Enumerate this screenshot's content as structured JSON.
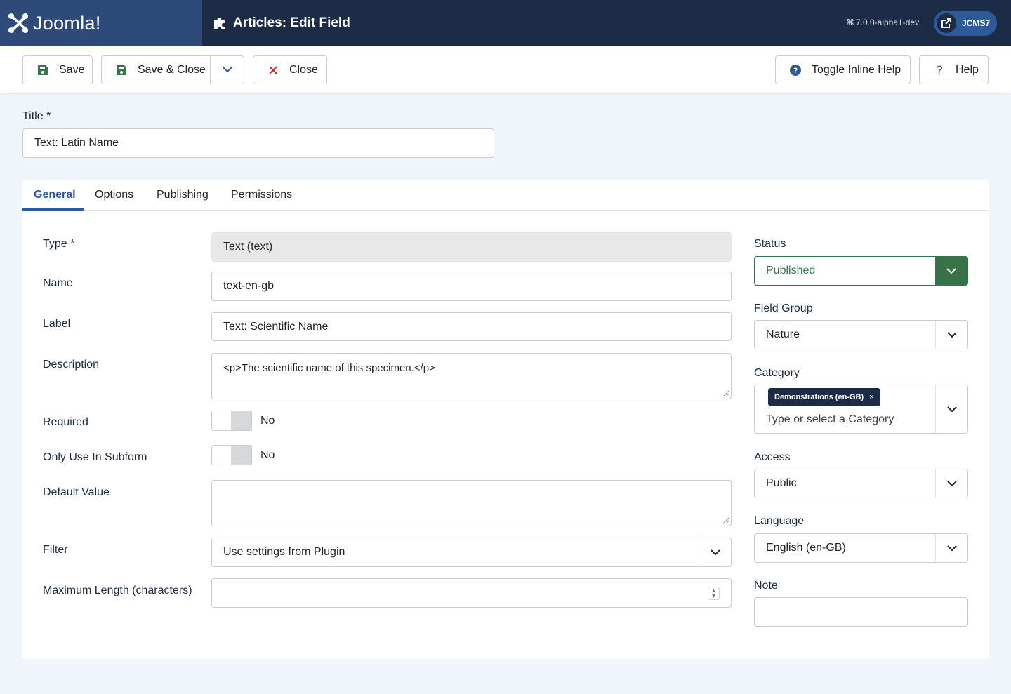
{
  "brand": {
    "name": "Joomla!"
  },
  "header": {
    "title": "Articles: Edit Field",
    "version": "7.0.0-alpha1-dev",
    "user": "JCMS7"
  },
  "toolbar": {
    "save_label": "Save",
    "save_close_label": "Save & Close",
    "close_label": "Close",
    "toggle_help_label": "Toggle Inline Help",
    "help_label": "Help",
    "help_glyph": "?"
  },
  "title_field": {
    "label": "Title *",
    "value": "Text: Latin Name"
  },
  "tabs": [
    {
      "label": "General"
    },
    {
      "label": "Options"
    },
    {
      "label": "Publishing"
    },
    {
      "label": "Permissions"
    }
  ],
  "general": {
    "type": {
      "label": "Type *",
      "value": "Text (text)"
    },
    "name": {
      "label": "Name",
      "value": "text-en-gb"
    },
    "label": {
      "label": "Label",
      "value": "Text: Scientific Name"
    },
    "description": {
      "label": "Description",
      "value": "<p>The scientific name of this specimen.</p>"
    },
    "required": {
      "label": "Required",
      "value": "No"
    },
    "only_subform": {
      "label": "Only Use In Subform",
      "value": "No"
    },
    "default_value": {
      "label": "Default Value",
      "value": ""
    },
    "filter": {
      "label": "Filter",
      "value": "Use settings from Plugin"
    },
    "max_length": {
      "label": "Maximum Length (characters)",
      "value": ""
    }
  },
  "sidebar": {
    "status": {
      "label": "Status",
      "value": "Published",
      "color": "#3a7247"
    },
    "field_group": {
      "label": "Field Group",
      "value": "Nature"
    },
    "category": {
      "label": "Category",
      "chip": "Demonstrations (en-GB)",
      "chip_remove": "×",
      "placeholder": "Type or select a Category"
    },
    "access": {
      "label": "Access",
      "value": "Public"
    },
    "language": {
      "label": "Language",
      "value": "English (en-GB)"
    },
    "note": {
      "label": "Note",
      "value": ""
    }
  },
  "colors": {
    "header_bg": "#1c2c47",
    "brand_bg": "#2e4a78",
    "accent": "#2e5a9a",
    "close_red": "#c52827",
    "save_green": "#3a7247"
  }
}
